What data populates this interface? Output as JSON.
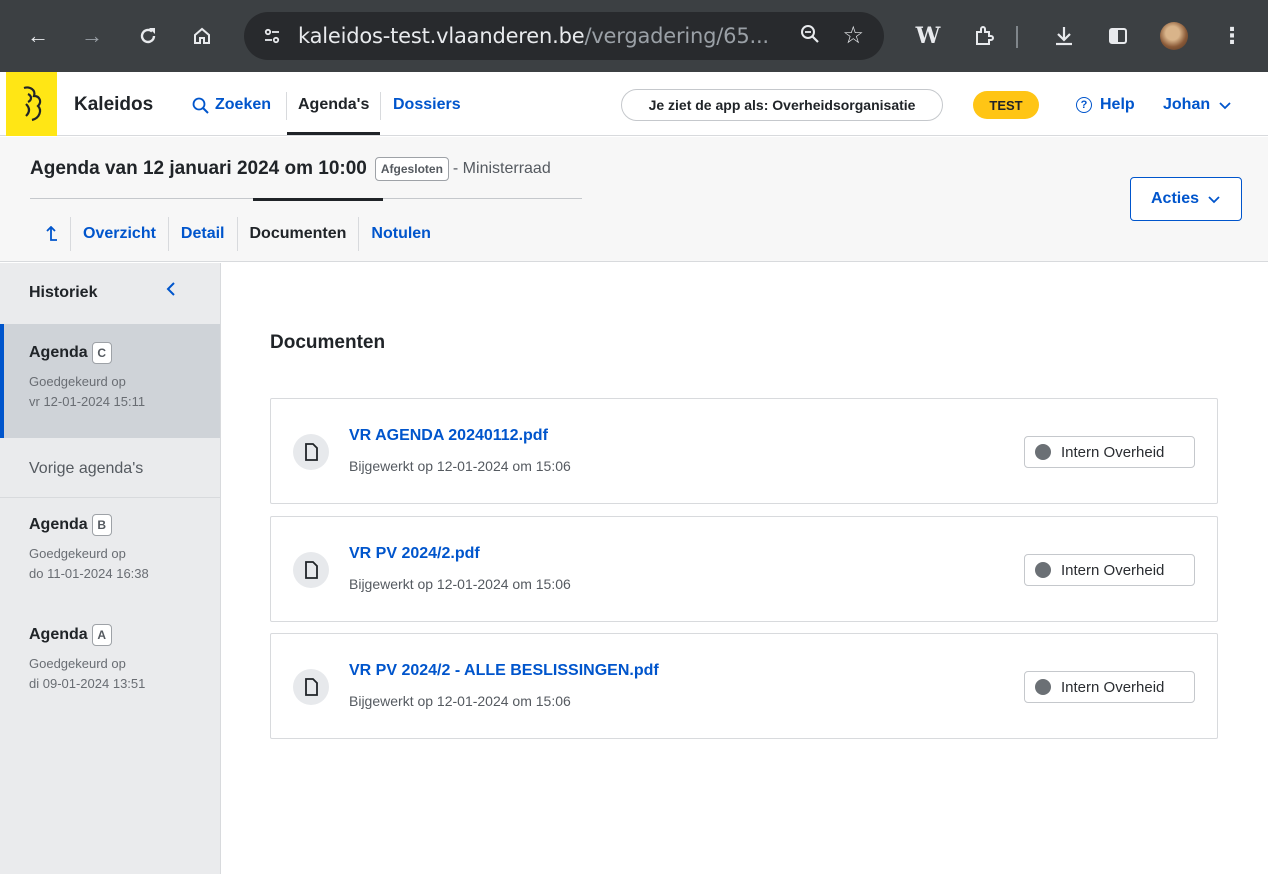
{
  "browser": {
    "url_host": "kaleidos-test.vlaanderen.be",
    "url_path": "/vergadering/65...",
    "icons": [
      "back-icon",
      "forward-icon",
      "reload-icon",
      "home-icon",
      "site-info-icon",
      "zoom-icon",
      "star-icon",
      "wikipedia-extension-icon",
      "extensions-icon",
      "download-icon",
      "sidepanel-icon",
      "profile-avatar",
      "menu-icon"
    ]
  },
  "header": {
    "brand": "Kaleidos",
    "nav": {
      "search": "Zoeken",
      "agendas": "Agenda's",
      "dossiers": "Dossiers"
    },
    "viewing_as": "Je ziet de app als: Overheidsorganisatie",
    "env_badge": "TEST",
    "help": "Help",
    "user": "Johan"
  },
  "meeting": {
    "title": "Agenda van 12 januari 2024 om 10:00",
    "status": "Afgesloten",
    "kind": "- Ministerraad",
    "tabs": {
      "overview": "Overzicht",
      "detail": "Detail",
      "documents": "Documenten",
      "minutes": "Notulen"
    },
    "actions_button": "Acties"
  },
  "sidebar": {
    "title": "Historiek",
    "current": {
      "label": "Agenda",
      "letter": "C",
      "status": "Goedgekeurd op",
      "date": "vr 12-01-2024 15:11"
    },
    "previous_title": "Vorige agenda's",
    "previous": [
      {
        "label": "Agenda",
        "letter": "B",
        "status": "Goedgekeurd op",
        "date": "do 11-01-2024 16:38"
      },
      {
        "label": "Agenda",
        "letter": "A",
        "status": "Goedgekeurd op",
        "date": "di 09-01-2024 13:51"
      }
    ]
  },
  "main": {
    "heading": "Documenten",
    "documents": [
      {
        "name": "VR AGENDA 20240112.pdf",
        "updated": "Bijgewerkt op 12-01-2024 om 15:06",
        "access": "Intern Overheid"
      },
      {
        "name": "VR PV 2024/2.pdf",
        "updated": "Bijgewerkt op 12-01-2024 om 15:06",
        "access": "Intern Overheid"
      },
      {
        "name": "VR PV 2024/2 - ALLE BESLISSINGEN.pdf",
        "updated": "Bijgewerkt op 12-01-2024 om 15:06",
        "access": "Intern Overheid"
      }
    ]
  },
  "colors": {
    "chrome_bg": "#3c4043",
    "link_blue": "#0055cc",
    "logo_yellow": "#ffe615",
    "badge_yellow": "#ffc515",
    "sidebar_bg": "#eaebed",
    "sidebar_selected": "#cfd3d8"
  }
}
